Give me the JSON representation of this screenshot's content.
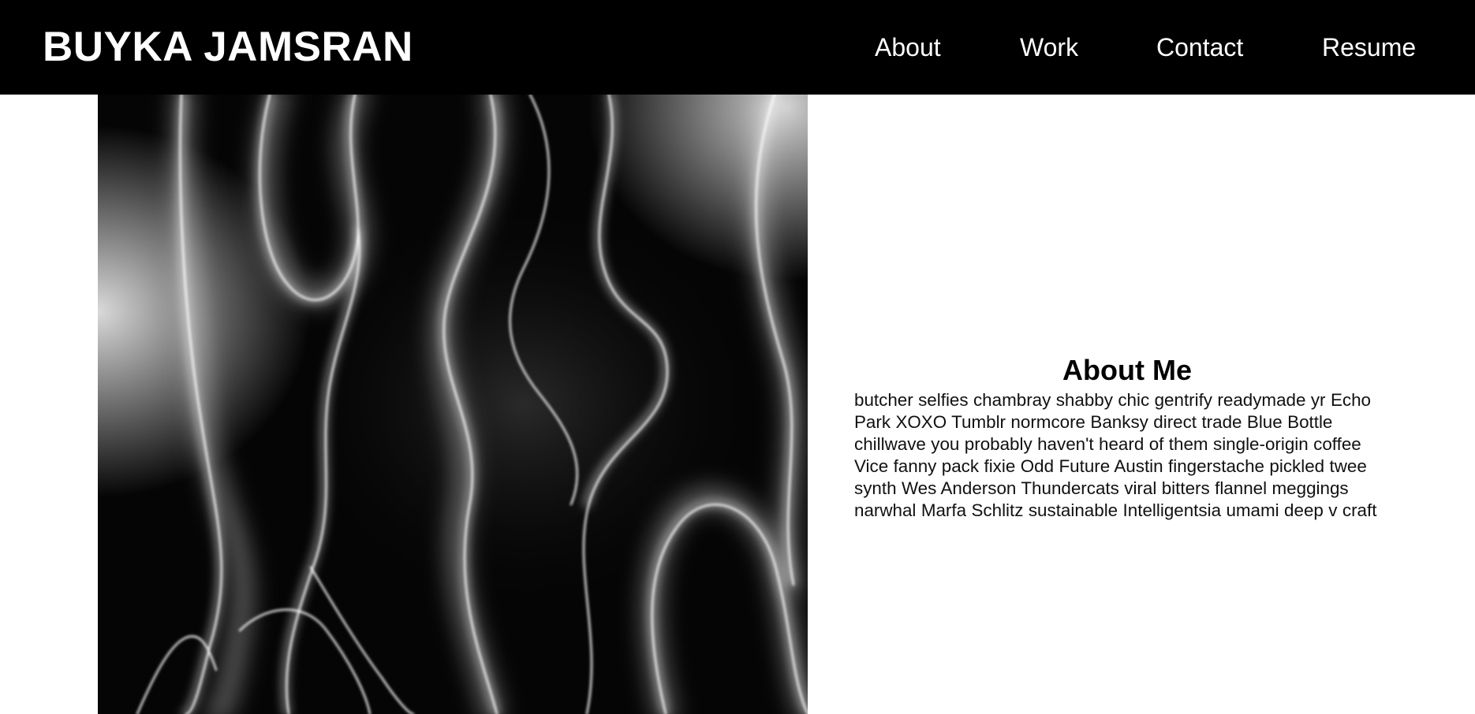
{
  "header": {
    "brand": "BUYKA JAMSRAN",
    "nav": [
      {
        "label": "About"
      },
      {
        "label": "Work"
      },
      {
        "label": "Contact"
      },
      {
        "label": "Resume"
      }
    ]
  },
  "hero": {
    "description": ""
  },
  "about": {
    "title": "About Me",
    "body": "butcher selfies chambray shabby chic gentrify readymade yr Echo Park XOXO Tumblr normcore Banksy direct trade Blue Bottle chillwave you probably haven't heard of them single-origin coffee Vice fanny pack fixie Odd Future Austin fingerstache pickled twee synth Wes Anderson Thundercats viral bitters flannel meggings narwhal Marfa Schlitz sustainable Intelligentsia umami deep v craft"
  },
  "colors": {
    "header_bg": "#000000",
    "header_text": "#ffffff",
    "page_bg": "#ffffff",
    "body_text": "#111111"
  }
}
